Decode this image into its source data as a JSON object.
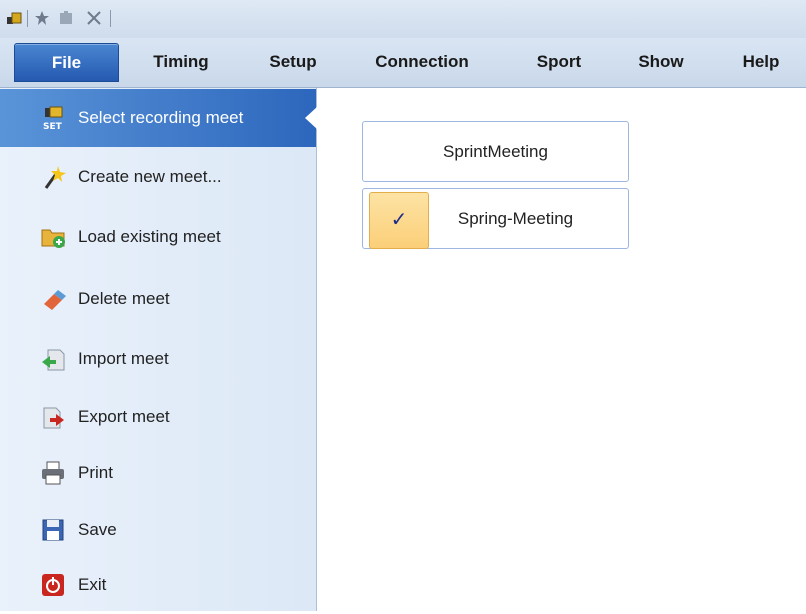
{
  "quick_access": {
    "icons": [
      "camera-icon",
      "star-icon",
      "puzzle-icon",
      "tools-icon"
    ]
  },
  "menubar": {
    "tabs": [
      {
        "label": "File",
        "active": true
      },
      {
        "label": "Timing"
      },
      {
        "label": "Setup"
      },
      {
        "label": "Connection"
      },
      {
        "label": "Sport"
      },
      {
        "label": "Show"
      },
      {
        "label": "Help"
      }
    ]
  },
  "file_menu": {
    "items": [
      {
        "label": "Select recording meet",
        "icon": "set-meet-icon",
        "active": true
      },
      {
        "label": "Create new meet...",
        "icon": "wand-icon"
      },
      {
        "label": "Load existing meet",
        "icon": "folder-add-icon"
      },
      {
        "label": "Delete meet",
        "icon": "eraser-icon"
      },
      {
        "label": "Import meet",
        "icon": "import-icon"
      },
      {
        "label": "Export meet",
        "icon": "export-icon"
      },
      {
        "label": "Print",
        "icon": "printer-icon"
      },
      {
        "label": "Save",
        "icon": "floppy-icon"
      },
      {
        "label": "Exit",
        "icon": "power-icon"
      }
    ]
  },
  "meets": {
    "items": [
      {
        "label": "SprintMeeting",
        "checked": false
      },
      {
        "label": "Spring-Meeting",
        "checked": true
      }
    ],
    "check_mark": "✓"
  },
  "colors": {
    "accent": "#2d67bd",
    "menu_bg": "#dce8f6",
    "check_bg": "#fbcf79"
  }
}
